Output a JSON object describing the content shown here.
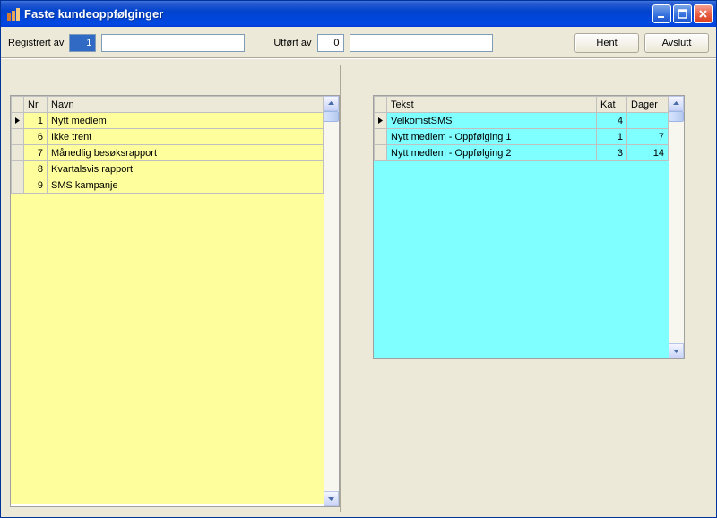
{
  "window": {
    "title": "Faste kundeoppfølginger"
  },
  "toolbar": {
    "registered_label": "Registrert av",
    "registered_value": "1",
    "registered_name": "",
    "performed_label": "Utført av",
    "performed_value": "0",
    "performed_name": "",
    "hent_label": "Hent",
    "avslutt_label": "Avslutt"
  },
  "left": {
    "columns": {
      "nr": "Nr",
      "navn": "Navn"
    },
    "rows": [
      {
        "nr": "1",
        "navn": "Nytt medlem"
      },
      {
        "nr": "6",
        "navn": "Ikke trent"
      },
      {
        "nr": "7",
        "navn": "Månedlig besøksrapport"
      },
      {
        "nr": "8",
        "navn": "Kvartalsvis rapport"
      },
      {
        "nr": "9",
        "navn": "SMS kampanje"
      }
    ]
  },
  "right": {
    "columns": {
      "tekst": "Tekst",
      "kat": "Kat",
      "dager": "Dager"
    },
    "rows": [
      {
        "tekst": "VelkomstSMS",
        "kat": "4",
        "dager": ""
      },
      {
        "tekst": "Nytt medlem - Oppfølging 1",
        "kat": "1",
        "dager": "7"
      },
      {
        "tekst": "Nytt medlem - Oppfølging 2",
        "kat": "3",
        "dager": "14"
      }
    ]
  }
}
